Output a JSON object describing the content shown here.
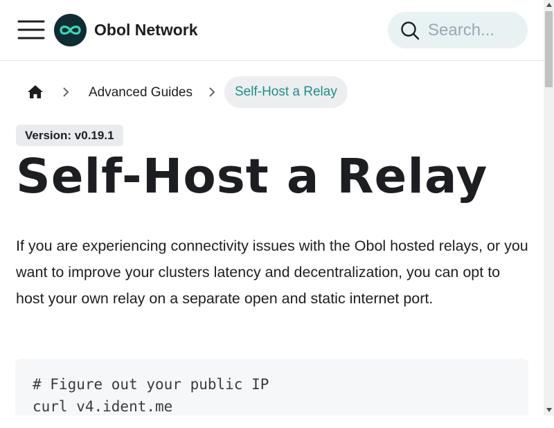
{
  "navbar": {
    "menu_icon": "hamburger-menu-icon",
    "logo_icon": "infinity-logo-icon",
    "brand": "Obol Network",
    "search": {
      "placeholder": "Search...",
      "value": "",
      "icon": "search-icon"
    }
  },
  "breadcrumb": {
    "home_icon": "home-icon",
    "separator_icon": "chevron-right-icon",
    "items": [
      {
        "label": "Advanced Guides"
      },
      {
        "label": "Self-Host a Relay",
        "active": true
      }
    ]
  },
  "version_badge": "Version: v0.19.1",
  "page_title": "Self-Host a Relay",
  "intro": "If you are experiencing connectivity issues with the Obol hosted relays, or you want to improve your clusters latency and decentralization, you can opt to host your own relay on a separate open and static internet port.",
  "code": {
    "lines": [
      "# Figure out your public IP",
      "curl v4.ident.me"
    ]
  },
  "colors": {
    "accent": "#1f8f86",
    "logo_bg": "#0f2d33",
    "logo_mark": "#3ed6b5",
    "search_bg": "#e8f2f2",
    "badge_bg": "#e9ebee",
    "code_bg": "#f6f7f8"
  }
}
